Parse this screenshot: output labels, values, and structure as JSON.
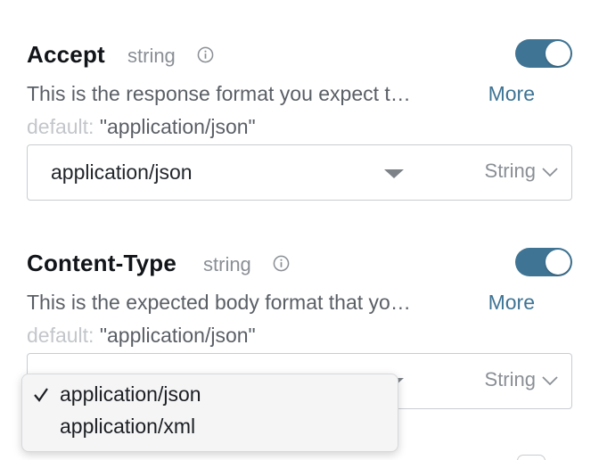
{
  "params": [
    {
      "name": "Accept",
      "type": "string",
      "enabled": true,
      "description": "This is the response format you expect t…",
      "more_label": "More",
      "default_label": "default:",
      "default_value": "\"application/json\"",
      "selected_value": "application/json",
      "value_type": "String"
    },
    {
      "name": "Content-Type",
      "type": "string",
      "enabled": true,
      "description": "This is the expected body format that yo…",
      "more_label": "More",
      "default_label": "default:",
      "default_value": "\"application/json\"",
      "selected_value": "application/json",
      "value_type": "String"
    }
  ],
  "dropdown": {
    "options": [
      {
        "label": "application/json",
        "selected": true
      },
      {
        "label": "application/xml",
        "selected": false
      }
    ]
  },
  "colors": {
    "accent": "#3f7494",
    "muted": "#8a8f95",
    "border": "#c9ccd0"
  },
  "icons": {
    "info": "info-circle-icon",
    "caret": "caret-down-icon",
    "chevron": "chevron-down-icon",
    "check": "checkmark-icon"
  }
}
